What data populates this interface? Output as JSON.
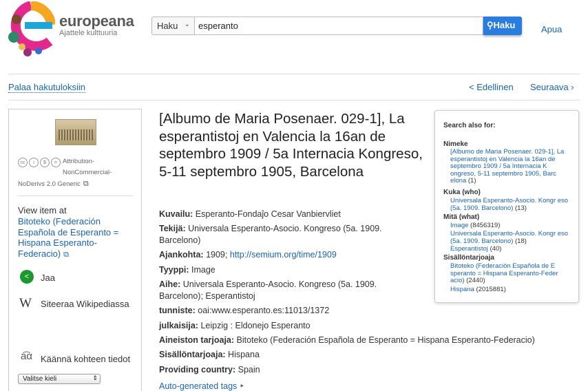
{
  "header": {
    "brand_name": "europeana",
    "brand_tagline": "Ajattele kulttuuria",
    "search_scope": "Haku",
    "search_value": "esperanto",
    "search_button": "Haku",
    "help_link": "Apua"
  },
  "nav": {
    "back": "Palaa hakutuloksiin",
    "prev": "<  Edellinen",
    "next": "Seuraava  ›"
  },
  "left": {
    "license_line1": "Attribution-",
    "license_line2": "NonCommercial-",
    "license_line3": "NoDerivs 2.0 Generic",
    "view_item_at": "View item at",
    "provider_link": "Bitoteko (Federación Española de Esperanto = Hispana Esperanto-Federacio)",
    "share": "Jaa",
    "cite": "Siteeraa Wikipediassa",
    "translate": "Käännä kohteen tiedot",
    "language_select": "Valitse kieli"
  },
  "record": {
    "title": "[Albumo de Maria Posenaer. 029-1], La esperantistoj en Valencia la 16an de septembro 1909 / 5a Internacia Kongreso, 5-11 septembro 1905, Barcelona",
    "fields": {
      "kuvailu_label": "Kuvailu:",
      "kuvailu_value": "Esperanto-Fondaĵo Cesar Vanbiervliet",
      "tekija_label": "Tekijä:",
      "tekija_value_1": "Universala Esperanto-Asocio. Kongreso (5a. 1909.",
      "tekija_value_2": "Barcelono)",
      "ajankohta_label": "Ajankohta:",
      "ajankohta_value": "1909;",
      "ajankohta_link": "http://semium.org/time/1909",
      "tyyppi_label": "Tyyppi:",
      "tyyppi_value": "Image",
      "aihe_label": "Aihe:",
      "aihe_value_1": "Universala Esperanto-Asocio. Kongreso (5a. 1909.",
      "aihe_value_2": "Barcelono); Esperantistoj",
      "tunniste_label": "tunniste:",
      "tunniste_value": "oai:www.esperanto.es:11013/1372",
      "julkaisija_label": "julkaisija:",
      "julkaisija_value": "Leipzig : Eldonejo Esperanto",
      "aineisto_label": "Aineiston tarjoaja:",
      "aineisto_value": "Bitoteko (Federación Española de Esperanto = Hispana Esperanto-Federacio)",
      "sisallon_label": "Sisällöntarjoaja:",
      "sisallon_value": "Hispana",
      "country_label": "Providing country:",
      "country_value": "Spain"
    },
    "auto_tags": "Auto-generated tags ‣"
  },
  "search_also": {
    "heading": "Search also for:",
    "groups": [
      {
        "title": "Nimeke",
        "items": [
          {
            "text": "[Albumo de Maria Posenaer. 029-1], La esperantistoj en Valencia la 16an de septembro 1909 / 5a Internacia K ongreso, 5-11 septembro 1905, Barc elona",
            "count": "(1)"
          }
        ]
      },
      {
        "title": "Kuka (who)",
        "items": [
          {
            "text": "Universala Esperanto-Asocio. Kongr eso (5a. 1909. Barcelono)",
            "count": "(13)"
          }
        ]
      },
      {
        "title": "Mitä (what)",
        "items": [
          {
            "text": "Image",
            "count": "(8456319)"
          },
          {
            "text": "Universala Esperanto-Asocio. Kongr eso (5a. 1909. Barcelono)",
            "count": "(18)"
          },
          {
            "text": "Esperantistoj",
            "count": "(40)"
          }
        ]
      },
      {
        "title": "Sisällöntarjoaja",
        "items": [
          {
            "text": "Bitoteko (Federación Española de E speranto = Hispana Esperanto-Feder acio)",
            "count": "(2440)"
          },
          {
            "text": "Hispana",
            "count": "(2015881)"
          }
        ]
      }
    ]
  }
}
